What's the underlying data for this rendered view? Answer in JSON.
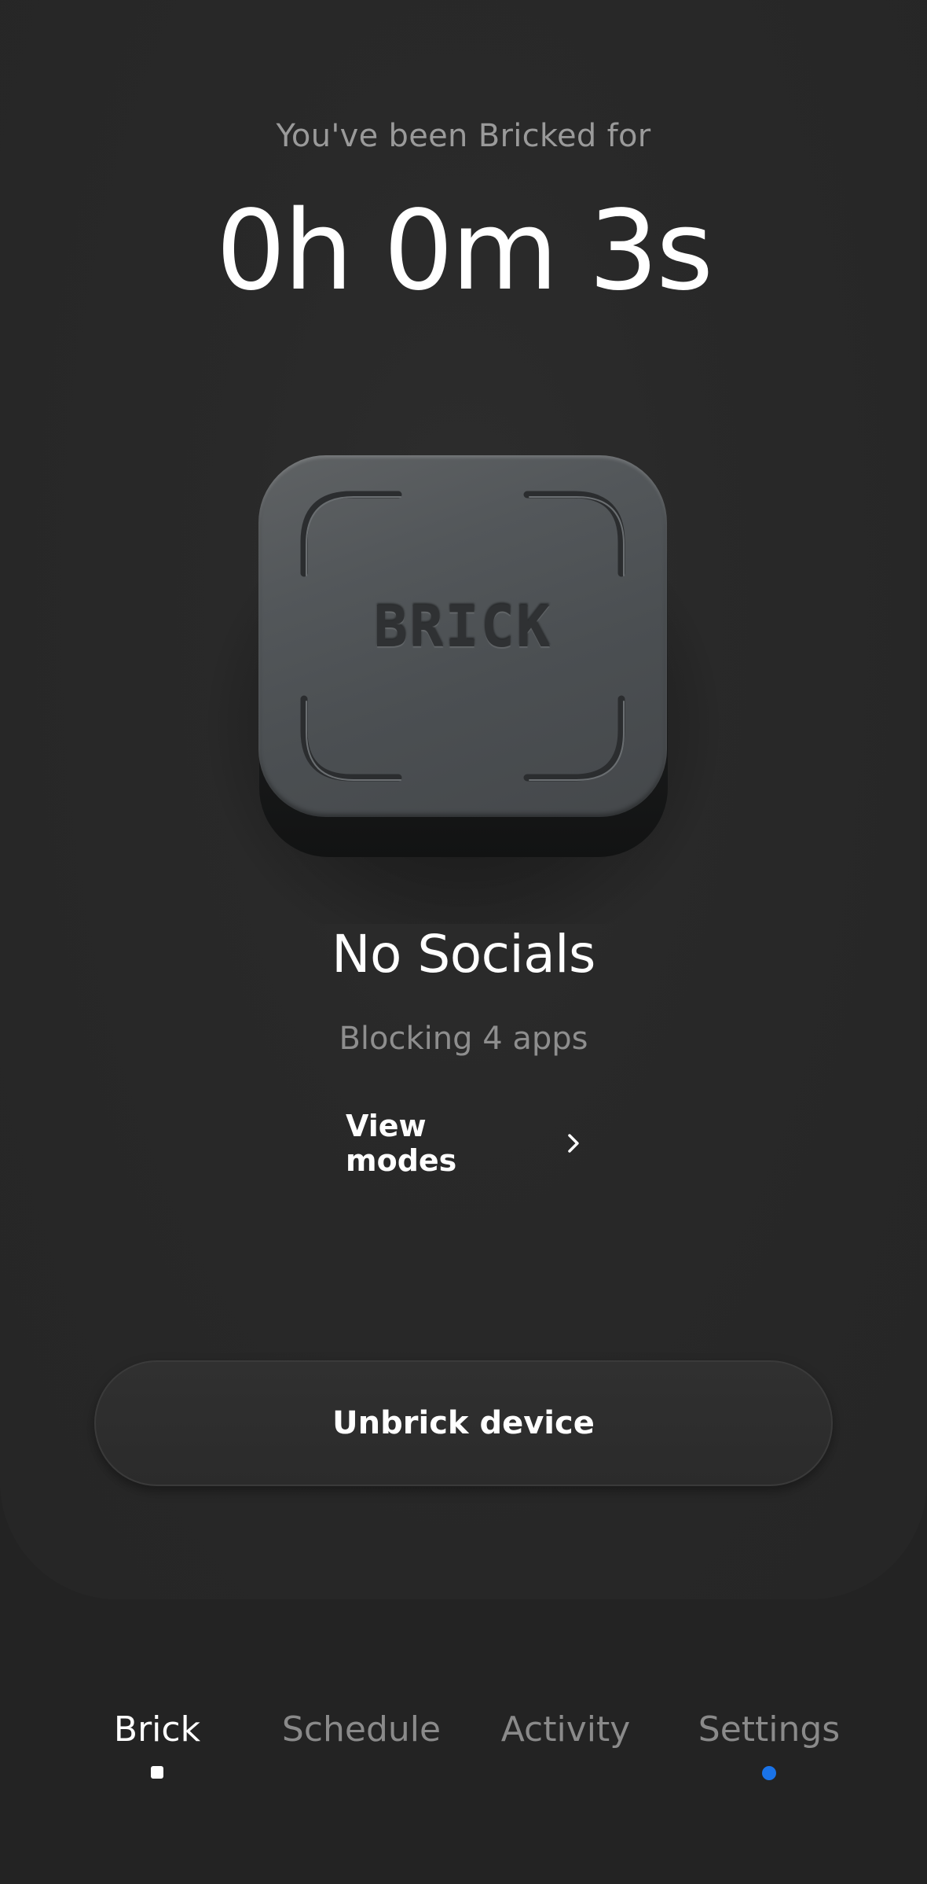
{
  "header": {
    "subtitle": "You've been Bricked for",
    "timer": "0h 0m 3s"
  },
  "device": {
    "label": "BRICK",
    "icon": "brick-device-icon"
  },
  "mode": {
    "title": "No Socials",
    "subtitle": "Blocking 4 apps",
    "view_modes_label": "View modes",
    "view_modes_icon": "chevron-right-icon"
  },
  "actions": {
    "unbrick_label": "Unbrick device"
  },
  "tabs": [
    {
      "label": "Brick",
      "active": true,
      "indicator": "white-square"
    },
    {
      "label": "Schedule",
      "active": false
    },
    {
      "label": "Activity",
      "active": false
    },
    {
      "label": "Settings",
      "active": false,
      "indicator": "blue-dot"
    }
  ],
  "colors": {
    "background": "#232323",
    "card": "#292929",
    "text_primary": "#ffffff",
    "text_secondary": "#8e8e8e",
    "accent_dot": "#1a73e8"
  }
}
